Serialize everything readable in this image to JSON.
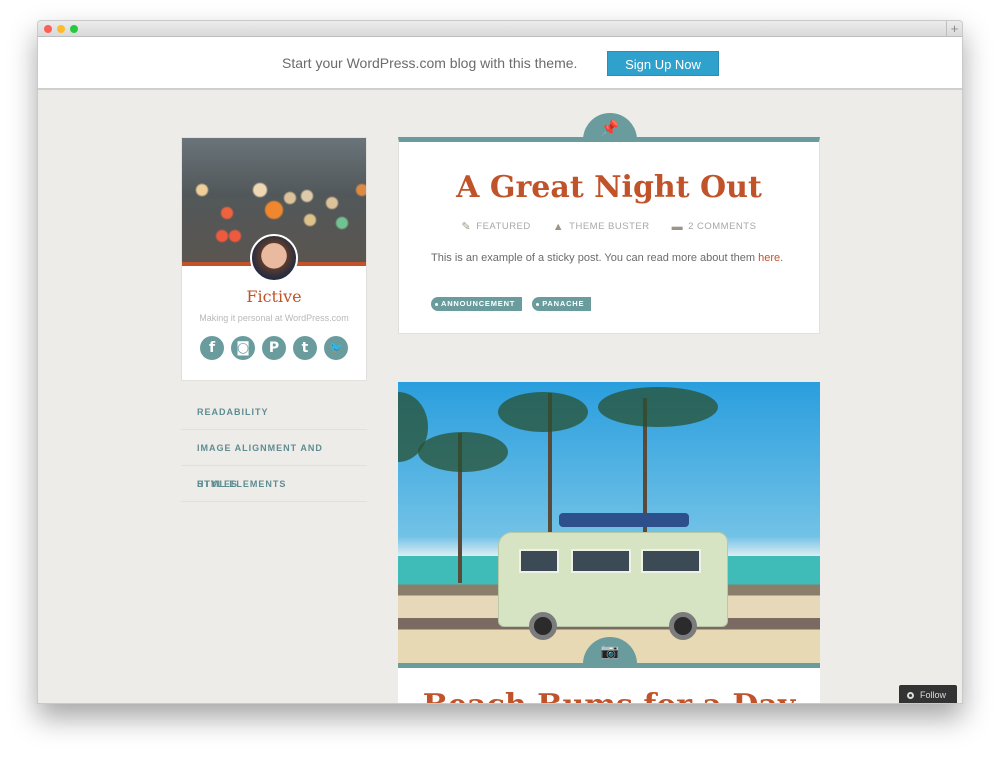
{
  "browser": {
    "new_tab_label": "+"
  },
  "signup_bar": {
    "text": "Start your WordPress.com blog with this theme.",
    "button_label": "Sign Up Now",
    "button_color": "#2ea2cc"
  },
  "sidebar": {
    "site_title": "Fictive",
    "site_description": "Making it personal at WordPress.com",
    "social": [
      {
        "name": "facebook-icon",
        "glyph": "f"
      },
      {
        "name": "instagram-icon",
        "glyph": "◙"
      },
      {
        "name": "pinterest-icon",
        "glyph": "P"
      },
      {
        "name": "tumblr-icon",
        "glyph": "t"
      },
      {
        "name": "twitter-icon",
        "glyph": "🐦"
      }
    ],
    "menu": [
      {
        "label": "READABILITY"
      },
      {
        "label": "IMAGE ALIGNMENT AND STYLES"
      },
      {
        "label": "HTML ELEMENTS"
      }
    ]
  },
  "posts": [
    {
      "format_icon": "pin-icon",
      "format_glyph": "📌",
      "title": "A Great Night Out",
      "meta": {
        "featured": "FEATURED",
        "author": "THEME BUSTER",
        "comments": "2 COMMENTS"
      },
      "excerpt_prefix": "This is an example of a sticky post. You can read more about them ",
      "excerpt_link": "here",
      "excerpt_suffix": ".",
      "tags": [
        "ANNOUNCEMENT",
        "PANACHE"
      ]
    },
    {
      "format_icon": "camera-icon",
      "format_glyph": "📷",
      "title": "Beach Bums for a Day"
    }
  ],
  "colors": {
    "accent": "#c1532a",
    "teal": "#6a9c9e",
    "background": "#eeece8"
  },
  "follow_button": {
    "label": "Follow"
  }
}
